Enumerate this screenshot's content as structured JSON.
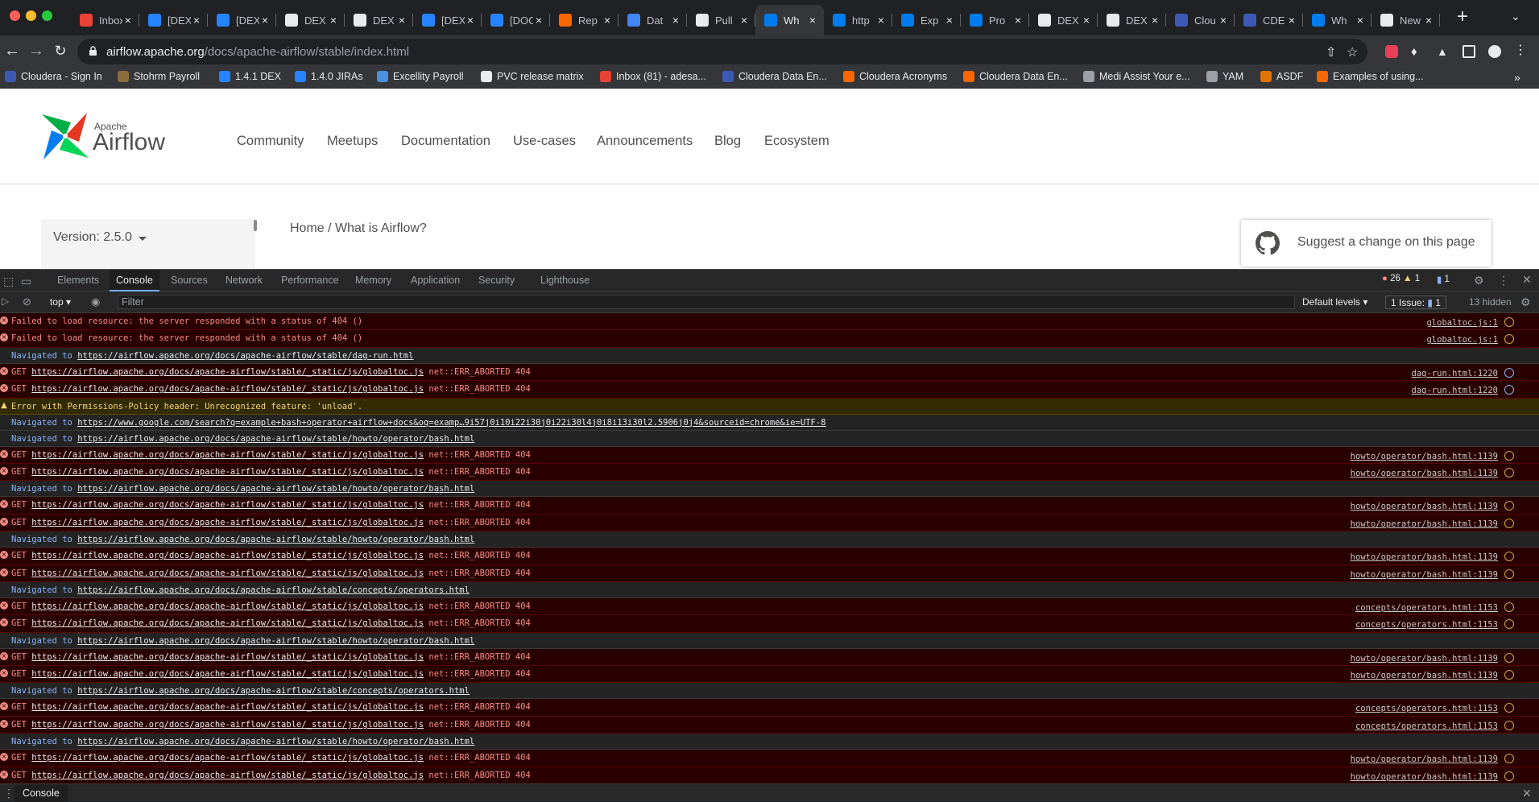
{
  "browser": {
    "tabs": [
      {
        "title": "Inbox",
        "favicon": "gmail-icon",
        "color": "#ea4335"
      },
      {
        "title": "[DEX",
        "favicon": "jira-icon",
        "color": "#2684ff"
      },
      {
        "title": "[DEX",
        "favicon": "jira-icon",
        "color": "#2684ff"
      },
      {
        "title": "DEX",
        "favicon": "github-icon",
        "color": "#e8eaed"
      },
      {
        "title": "DEX",
        "favicon": "github-icon",
        "color": "#e8eaed"
      },
      {
        "title": "[DEX",
        "favicon": "jira-icon",
        "color": "#2684ff"
      },
      {
        "title": "[DOC",
        "favicon": "jira-icon",
        "color": "#2684ff"
      },
      {
        "title": "Rep",
        "favicon": "cloudera-icon",
        "color": "#f96702"
      },
      {
        "title": "Dat",
        "favicon": "docs-icon",
        "color": "#4285f4"
      },
      {
        "title": "Pull",
        "favicon": "github-icon",
        "color": "#e8eaed"
      },
      {
        "title": "Wh",
        "favicon": "airflow-icon",
        "color": "#017cee",
        "active": true
      },
      {
        "title": "http",
        "favicon": "airflow-icon",
        "color": "#017cee"
      },
      {
        "title": "Exp",
        "favicon": "airflow-icon",
        "color": "#017cee"
      },
      {
        "title": "Pro",
        "favicon": "airflow-icon",
        "color": "#017cee"
      },
      {
        "title": "DEX",
        "favicon": "github-icon",
        "color": "#e8eaed"
      },
      {
        "title": "DEX",
        "favicon": "github-icon",
        "color": "#e8eaed"
      },
      {
        "title": "Clou",
        "favicon": "cloudera-cde-icon",
        "color": "#3c5ab5"
      },
      {
        "title": "CDE",
        "favicon": "cloudera-cde-icon",
        "color": "#3c5ab5"
      },
      {
        "title": "Wh",
        "favicon": "airflow-icon",
        "color": "#017cee"
      },
      {
        "title": "New",
        "favicon": "github-icon",
        "color": "#e8eaed"
      }
    ],
    "url_host": "airflow.apache.org",
    "url_path": "/docs/apache-airflow/stable/index.html",
    "bookmarks": [
      {
        "label": "Cloudera - Sign In",
        "favicon": "cloudera-icon",
        "color": "#3c5ab5"
      },
      {
        "label": "Stohrm Payroll",
        "favicon": "payroll-icon",
        "color": "#8a6d3b"
      },
      {
        "label": "1.4.1 DEX",
        "favicon": "jira-icon",
        "color": "#2684ff"
      },
      {
        "label": "1.4.0 JIRAs",
        "favicon": "jira-icon",
        "color": "#2684ff"
      },
      {
        "label": "Excellity Payroll",
        "favicon": "excellity-icon",
        "color": "#4a90e2"
      },
      {
        "label": "PVC release matrix",
        "favicon": "confluence-icon",
        "color": "#e8eaed"
      },
      {
        "label": "Inbox (81) - adesa...",
        "favicon": "gmail-icon",
        "color": "#ea4335"
      },
      {
        "label": "Cloudera Data En...",
        "favicon": "cloudera-cde-icon",
        "color": "#3c5ab5"
      },
      {
        "label": "Cloudera Acronyms",
        "favicon": "cloudera-icon",
        "color": "#f96702"
      },
      {
        "label": "Cloudera Data En...",
        "favicon": "cloudera-icon",
        "color": "#f96702"
      },
      {
        "label": "Medi Assist Your e...",
        "favicon": "globe-icon",
        "color": "#9aa0a6"
      },
      {
        "label": "YAM",
        "favicon": "globe-icon",
        "color": "#9aa0a6"
      },
      {
        "label": "ASDF",
        "favicon": "asdf-icon",
        "color": "#e37400"
      },
      {
        "label": "Examples of using...",
        "favicon": "cloudera-icon",
        "color": "#f96702"
      }
    ]
  },
  "site": {
    "logo_small": "Apache",
    "logo_big": "Airflow",
    "nav": [
      "Community",
      "Meetups",
      "Documentation",
      "Use-cases",
      "Announcements",
      "Blog",
      "Ecosystem"
    ],
    "version_label": "Version: 2.5.0",
    "breadcrumb": "Home / What is Airflow?",
    "suggest_label": "Suggest a change on this page"
  },
  "devtools": {
    "tabs": [
      "Elements",
      "Console",
      "Sources",
      "Network",
      "Performance",
      "Memory",
      "Application",
      "Security",
      "Lighthouse"
    ],
    "active_tab": "Console",
    "error_count": "26",
    "warning_count": "1",
    "message_count": "1",
    "context": "top",
    "filter_placeholder": "Filter",
    "levels": "Default levels",
    "issues": "1 Issue:",
    "issues_count": "1",
    "hidden": "13 hidden",
    "drawer_tab": "Console",
    "log": [
      {
        "type": "error",
        "text": "Failed to load resource: the server responded with a status of 404 ()",
        "source": "globaltoc.js:1"
      },
      {
        "type": "error",
        "text": "Failed to load resource: the server responded with a status of 404 ()",
        "source": "globaltoc.js:1"
      },
      {
        "type": "info",
        "prefix": "Navigated to",
        "url": "https://airflow.apache.org/docs/apache-airflow/stable/dag-run.html"
      },
      {
        "type": "error",
        "method": "GET",
        "url": "https://airflow.apache.org/docs/apache-airflow/stable/_static/js/globaltoc.js",
        "status": "net::ERR_ABORTED 404",
        "source": "dag-run.html:1220"
      },
      {
        "type": "error",
        "method": "GET",
        "url": "https://airflow.apache.org/docs/apache-airflow/stable/_static/js/globaltoc.js",
        "status": "net::ERR_ABORTED 404",
        "source": "dag-run.html:1220"
      },
      {
        "type": "warn",
        "text": "Error with Permissions-Policy header: Unrecognized feature: 'unload'."
      },
      {
        "type": "info",
        "prefix": "Navigated to",
        "url": "https://www.google.com/search?q=example+bash+operator+airflow+docs&oq=examp…9i57j0i10i22i30j0i22i30l4j0i8i13i30l2.5906j0j4&sourceid=chrome&ie=UTF-8"
      },
      {
        "type": "info",
        "prefix": "Navigated to",
        "url": "https://airflow.apache.org/docs/apache-airflow/stable/howto/operator/bash.html"
      },
      {
        "type": "error",
        "method": "GET",
        "url": "https://airflow.apache.org/docs/apache-airflow/stable/_static/js/globaltoc.js",
        "status": "net::ERR_ABORTED 404",
        "source": "howto/operator/bash.html:1139"
      },
      {
        "type": "error",
        "method": "GET",
        "url": "https://airflow.apache.org/docs/apache-airflow/stable/_static/js/globaltoc.js",
        "status": "net::ERR_ABORTED 404",
        "source": "howto/operator/bash.html:1139"
      },
      {
        "type": "info",
        "prefix": "Navigated to",
        "url": "https://airflow.apache.org/docs/apache-airflow/stable/howto/operator/bash.html"
      },
      {
        "type": "error",
        "method": "GET",
        "url": "https://airflow.apache.org/docs/apache-airflow/stable/_static/js/globaltoc.js",
        "status": "net::ERR_ABORTED 404",
        "source": "howto/operator/bash.html:1139"
      },
      {
        "type": "error",
        "method": "GET",
        "url": "https://airflow.apache.org/docs/apache-airflow/stable/_static/js/globaltoc.js",
        "status": "net::ERR_ABORTED 404",
        "source": "howto/operator/bash.html:1139"
      },
      {
        "type": "info",
        "prefix": "Navigated to",
        "url": "https://airflow.apache.org/docs/apache-airflow/stable/howto/operator/bash.html"
      },
      {
        "type": "error",
        "method": "GET",
        "url": "https://airflow.apache.org/docs/apache-airflow/stable/_static/js/globaltoc.js",
        "status": "net::ERR_ABORTED 404",
        "source": "howto/operator/bash.html:1139"
      },
      {
        "type": "error",
        "method": "GET",
        "url": "https://airflow.apache.org/docs/apache-airflow/stable/_static/js/globaltoc.js",
        "status": "net::ERR_ABORTED 404",
        "source": "howto/operator/bash.html:1139"
      },
      {
        "type": "info",
        "prefix": "Navigated to",
        "url": "https://airflow.apache.org/docs/apache-airflow/stable/concepts/operators.html"
      },
      {
        "type": "error",
        "method": "GET",
        "url": "https://airflow.apache.org/docs/apache-airflow/stable/_static/js/globaltoc.js",
        "status": "net::ERR_ABORTED 404",
        "source": "concepts/operators.html:1153"
      },
      {
        "type": "error",
        "method": "GET",
        "url": "https://airflow.apache.org/docs/apache-airflow/stable/_static/js/globaltoc.js",
        "status": "net::ERR_ABORTED 404",
        "source": "concepts/operators.html:1153"
      },
      {
        "type": "info",
        "prefix": "Navigated to",
        "url": "https://airflow.apache.org/docs/apache-airflow/stable/howto/operator/bash.html"
      },
      {
        "type": "error",
        "method": "GET",
        "url": "https://airflow.apache.org/docs/apache-airflow/stable/_static/js/globaltoc.js",
        "status": "net::ERR_ABORTED 404",
        "source": "howto/operator/bash.html:1139"
      },
      {
        "type": "error",
        "method": "GET",
        "url": "https://airflow.apache.org/docs/apache-airflow/stable/_static/js/globaltoc.js",
        "status": "net::ERR_ABORTED 404",
        "source": "howto/operator/bash.html:1139"
      },
      {
        "type": "info",
        "prefix": "Navigated to",
        "url": "https://airflow.apache.org/docs/apache-airflow/stable/concepts/operators.html"
      },
      {
        "type": "error",
        "method": "GET",
        "url": "https://airflow.apache.org/docs/apache-airflow/stable/_static/js/globaltoc.js",
        "status": "net::ERR_ABORTED 404",
        "source": "concepts/operators.html:1153"
      },
      {
        "type": "error",
        "method": "GET",
        "url": "https://airflow.apache.org/docs/apache-airflow/stable/_static/js/globaltoc.js",
        "status": "net::ERR_ABORTED 404",
        "source": "concepts/operators.html:1153"
      },
      {
        "type": "info",
        "prefix": "Navigated to",
        "url": "https://airflow.apache.org/docs/apache-airflow/stable/howto/operator/bash.html"
      },
      {
        "type": "error",
        "method": "GET",
        "url": "https://airflow.apache.org/docs/apache-airflow/stable/_static/js/globaltoc.js",
        "status": "net::ERR_ABORTED 404",
        "source": "howto/operator/bash.html:1139"
      },
      {
        "type": "error",
        "method": "GET",
        "url": "https://airflow.apache.org/docs/apache-airflow/stable/_static/js/globaltoc.js",
        "status": "net::ERR_ABORTED 404",
        "source": "howto/operator/bash.html:1139"
      }
    ]
  }
}
